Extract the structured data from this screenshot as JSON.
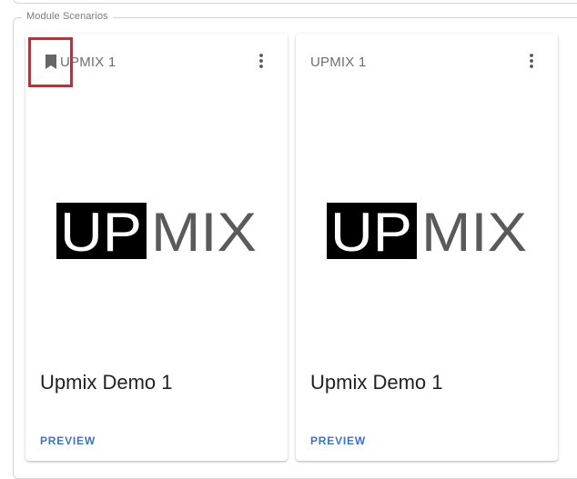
{
  "section": {
    "legend": "Module Scenarios"
  },
  "cards": [
    {
      "tag": "UPMIX 1",
      "logo_text_left": "UP",
      "logo_text_right": "MIX",
      "title": "Upmix Demo 1",
      "action": "PREVIEW",
      "bookmark_icon": "bookmark-icon",
      "menu_icon": "more-vert-icon"
    },
    {
      "tag": "UPMIX 1",
      "logo_text_left": "UP",
      "logo_text_right": "MIX",
      "title": "Upmix Demo 1",
      "action": "PREVIEW",
      "menu_icon": "more-vert-icon"
    }
  ],
  "colors": {
    "accent": "#3b74c4",
    "highlight": "#e0202a",
    "logo_dark": "#000000",
    "logo_gray": "#5a5a5a"
  }
}
